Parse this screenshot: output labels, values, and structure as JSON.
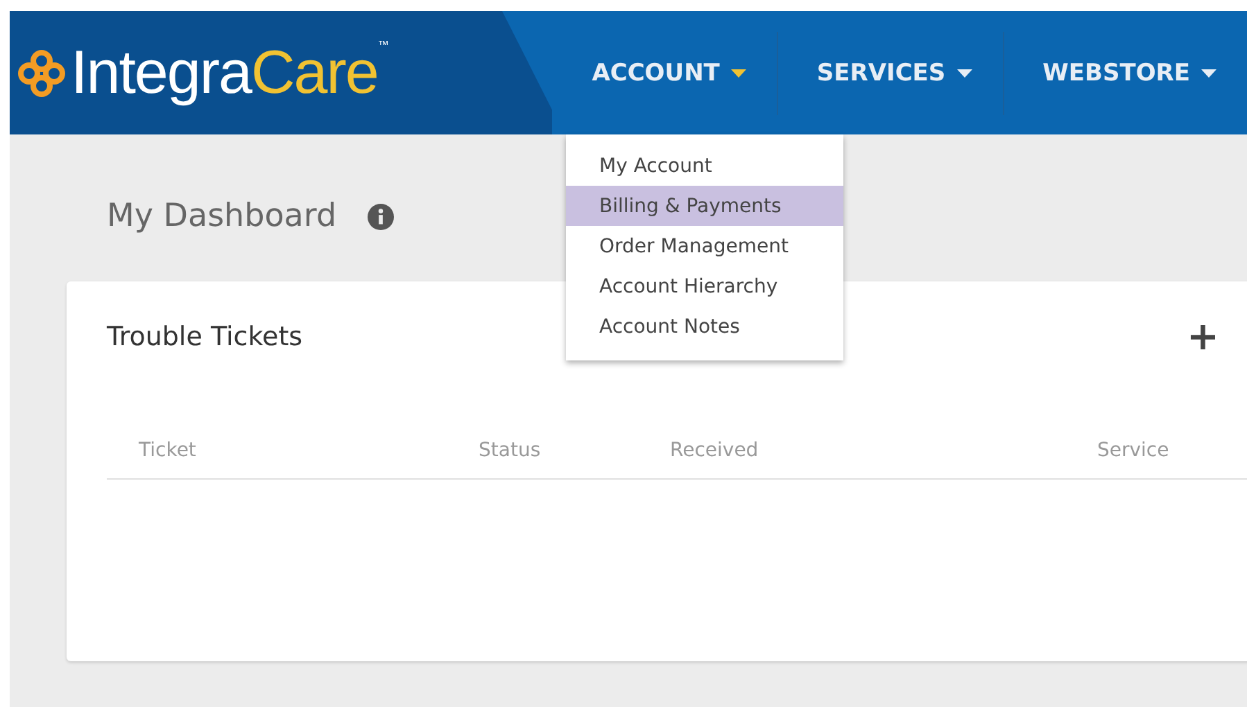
{
  "logo": {
    "text_1": "Integra",
    "text_2": "Care",
    "mark": "™"
  },
  "nav": [
    {
      "label": "ACCOUNT",
      "expanded": true
    },
    {
      "label": "SERVICES",
      "expanded": false
    },
    {
      "label": "WEBSTORE",
      "expanded": false
    }
  ],
  "dropdown": [
    {
      "label": "My Account",
      "selected": false
    },
    {
      "label": "Billing & Payments",
      "selected": true
    },
    {
      "label": "Order Management",
      "selected": false
    },
    {
      "label": "Account Hierarchy",
      "selected": false
    },
    {
      "label": "Account Notes",
      "selected": false
    }
  ],
  "page_title": "My Dashboard",
  "card": {
    "title": "Trouble Tickets",
    "add": "+",
    "columns": [
      "Ticket",
      "Status",
      "Received",
      "Service"
    ]
  }
}
